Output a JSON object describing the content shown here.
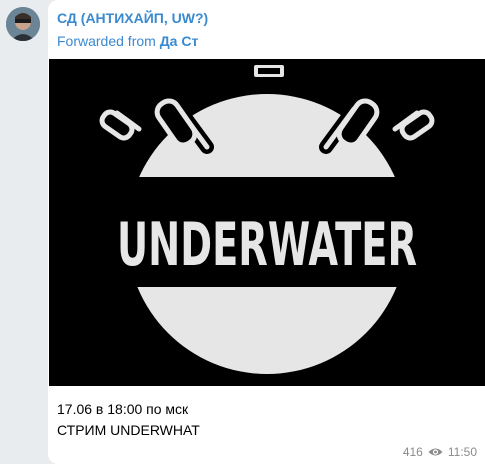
{
  "message": {
    "sender": "СД (АНТИХАЙП, UW?)",
    "forwarded_prefix": "Forwarded from",
    "forwarded_from": "Да Ст",
    "image_text": "UNDERWATER",
    "caption_line1": "17.06 в 18:00 по мск",
    "caption_line2": "СТРИМ UNDERWHAT",
    "views": "416",
    "time": "11:50"
  },
  "colors": {
    "accent": "#3a8ad1",
    "background": "#e9ecef",
    "bubble": "#ffffff",
    "image_bg": "#000000",
    "image_mine": "#e6e6e6"
  },
  "icons": {
    "views": "eye-icon"
  }
}
